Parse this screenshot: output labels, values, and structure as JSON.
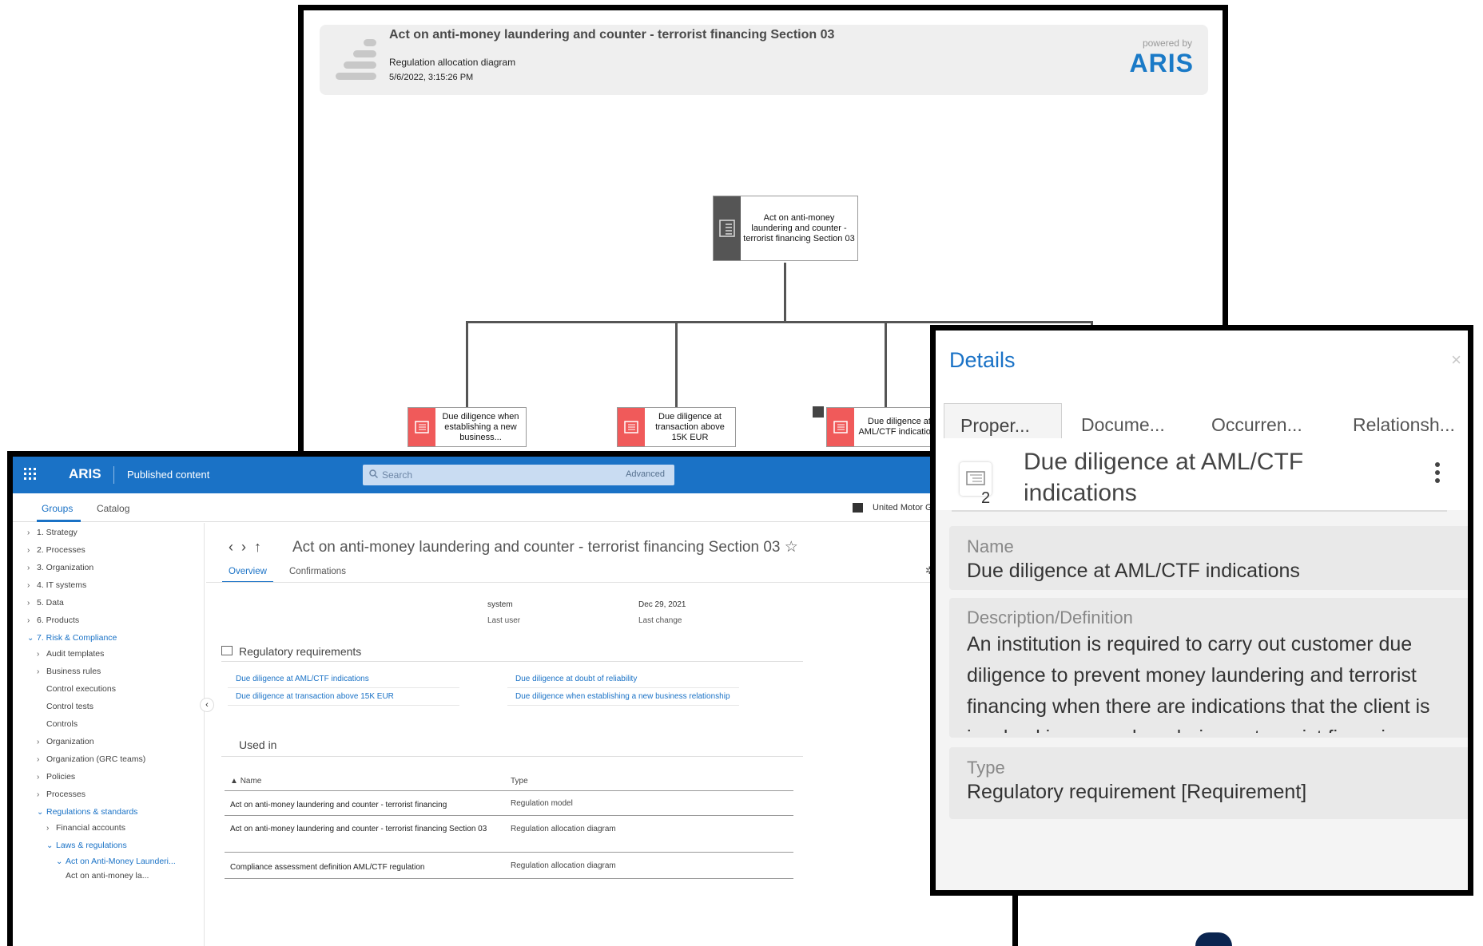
{
  "diagram": {
    "header": {
      "title": "Act on anti-money laundering and counter - terrorist financing Section 03",
      "subtitle": "Regulation allocation diagram",
      "date": "5/6/2022, 3:15:26 PM",
      "powered_by": "powered by",
      "logo": "ARIS"
    },
    "root_node": {
      "label": "Act on anti-money laundering and counter - terrorist financing Section 03",
      "icon": "regulation-icon"
    },
    "child_nodes": [
      {
        "label": "Due diligence when establishing a new business...",
        "icon": "requirement-icon"
      },
      {
        "label": "Due diligence at transaction above 15K EUR",
        "icon": "requirement-icon"
      },
      {
        "label": "Due diligence at AML/CTF indications",
        "icon": "requirement-icon"
      }
    ]
  },
  "portal": {
    "topbar": {
      "app_name": "ARIS",
      "section": "Published content",
      "search_placeholder": "Search",
      "search_advanced": "Advanced"
    },
    "tabs": {
      "groups": "Groups",
      "catalog": "Catalog"
    },
    "database": "United Motor Gr",
    "tree": [
      {
        "label": "1. Strategy"
      },
      {
        "label": "2. Processes"
      },
      {
        "label": "3. Organization"
      },
      {
        "label": "4. IT systems"
      },
      {
        "label": "5. Data"
      },
      {
        "label": "6. Products"
      },
      {
        "label": "7. Risk & Compliance"
      },
      {
        "label": "Audit templates"
      },
      {
        "label": "Business rules"
      },
      {
        "label": "Control executions"
      },
      {
        "label": "Control tests"
      },
      {
        "label": "Controls"
      },
      {
        "label": "Organization"
      },
      {
        "label": "Organization (GRC teams)"
      },
      {
        "label": "Policies"
      },
      {
        "label": "Processes"
      },
      {
        "label": "Regulations & standards"
      },
      {
        "label": "Financial accounts"
      },
      {
        "label": "Laws & regulations"
      },
      {
        "label": "Act on Anti-Money Launderi..."
      },
      {
        "label": "Act on anti-money la..."
      }
    ],
    "content": {
      "title": "Act on anti-money laundering and counter - terrorist financing Section 03 ☆",
      "tabs": {
        "overview": "Overview",
        "confirmations": "Confirmations"
      },
      "meta": {
        "last_user_value": "system",
        "last_user_label": "Last user",
        "last_change_value": "Dec 29, 2021",
        "last_change_label": "Last change"
      },
      "requirements_heading": "Regulatory requirements",
      "requirements": [
        "Due diligence at AML/CTF indications",
        "Due diligence at doubt of reliability",
        "Due diligence at transaction above 15K EUR",
        "Due diligence when establishing a new business relationship"
      ],
      "used_in_heading": "Used in",
      "table_headers": {
        "name": "Name",
        "type": "Type"
      },
      "table_rows": [
        {
          "name": "Act on anti-money laundering and counter - terrorist financing",
          "type": "Regulation model"
        },
        {
          "name": "Act on anti-money laundering and counter - terrorist financing Section 03",
          "type": "Regulation allocation diagram"
        },
        {
          "name": "Compliance assessment definition AML/CTF regulation",
          "type": "Regulation allocation diagram"
        }
      ]
    }
  },
  "details": {
    "title": "Details",
    "close": "×",
    "tabs": [
      "Proper...",
      "Docume...",
      "Occurren...",
      "Relationsh..."
    ],
    "object_title": "Due diligence at AML/CTF indications",
    "object_badge": "2",
    "properties": [
      {
        "label": "Name",
        "value": "Due diligence at AML/CTF indications"
      },
      {
        "label": "Description/Definition",
        "value": "An institution is required to carry out customer due diligence to prevent money laundering and terrorist financing when there are indications that the client is involved in money laundering or terrorist financing"
      },
      {
        "label": "Type",
        "value": "Regulatory requirement [Requirement]"
      }
    ]
  }
}
